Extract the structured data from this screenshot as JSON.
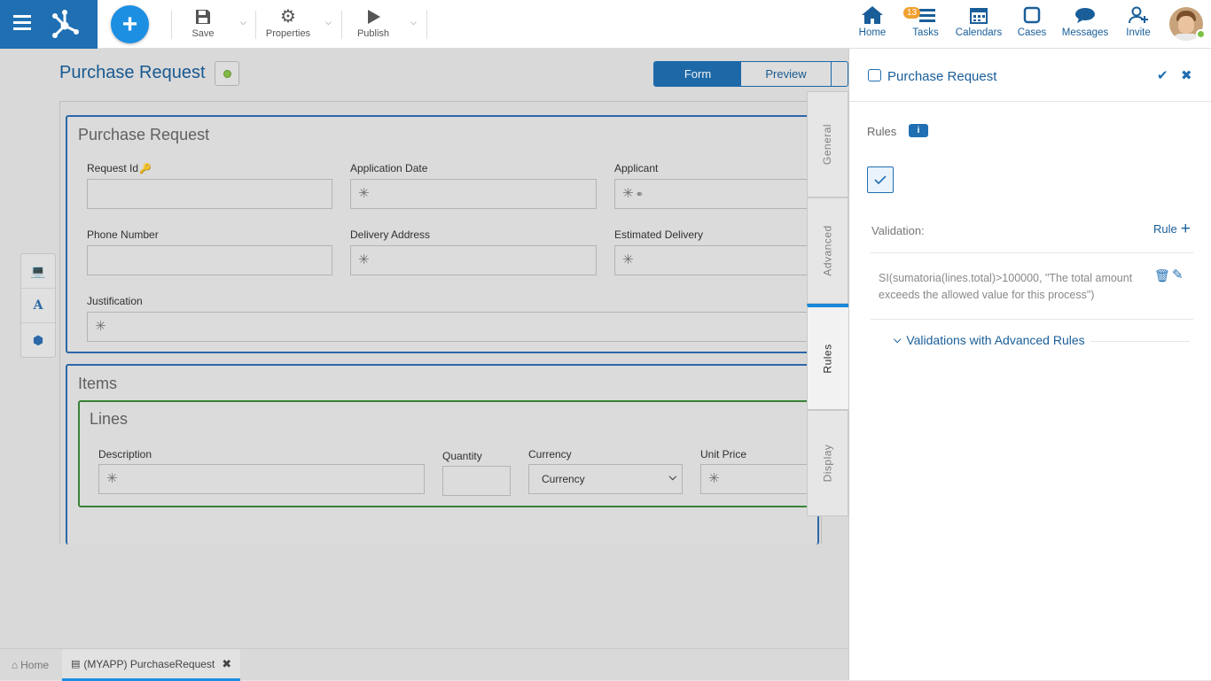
{
  "toolbar": {
    "save_label": "Save",
    "properties_label": "Properties",
    "publish_label": "Publish"
  },
  "nav": {
    "home": "Home",
    "tasks": "Tasks",
    "tasks_badge": "13",
    "calendars": "Calendars",
    "cases": "Cases",
    "messages": "Messages",
    "invite": "Invite"
  },
  "page": {
    "title": "Purchase Request",
    "view_tabs": [
      "Form",
      "Preview"
    ]
  },
  "form": {
    "section1_title": "Purchase Request",
    "fields": {
      "request_id": "Request Id",
      "application_date": "Application Date",
      "applicant": "Applicant",
      "phone_number": "Phone Number",
      "delivery_address": "Delivery Address",
      "estimated_delivery": "Estimated Delivery",
      "justification": "Justification"
    },
    "section2_title": "Items",
    "lines_title": "Lines",
    "line_fields": {
      "description": "Description",
      "quantity": "Quantity",
      "currency": "Currency",
      "currency_value": "Currency",
      "unit_price": "Unit Price"
    },
    "placeholder_glyph": "✳"
  },
  "vtabs": [
    "General",
    "Advanced",
    "Rules",
    "Display"
  ],
  "panel": {
    "title": "Purchase Request",
    "rules_label": "Rules",
    "validation_label": "Validation:",
    "rule_add_label": "Rule",
    "rule_text": "SI(sumatoria(lines.total)>100000, \"The total amount exceeds the allowed value for this process\")",
    "advanced_rules_label": "Validations with Advanced Rules"
  },
  "footer": {
    "home_tab": "Home",
    "doc_tab": "(MYAPP) PurchaseRequest"
  },
  "colors": {
    "brand": "#1f6fb2",
    "accent": "#1c8fe3",
    "link": "#1a5e99",
    "badge": "#f0a030",
    "section_border": "#2f6db3",
    "lines_border": "#3c8a3c",
    "status_dot": "#8bc34a"
  }
}
